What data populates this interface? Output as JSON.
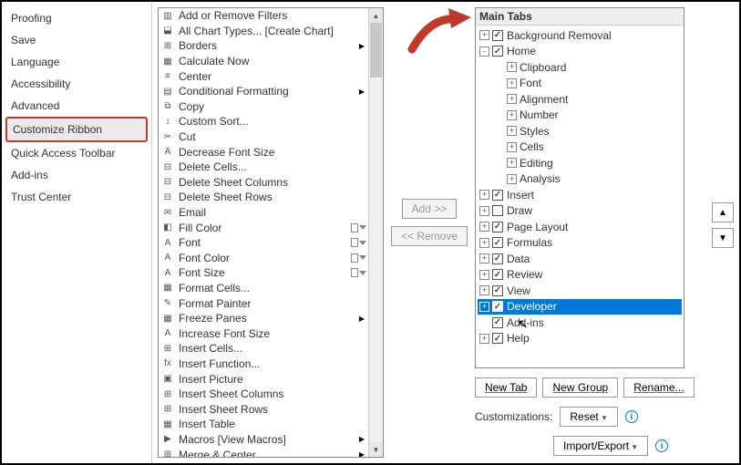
{
  "nav": {
    "items": [
      {
        "label": "Proofing"
      },
      {
        "label": "Save"
      },
      {
        "label": "Language"
      },
      {
        "label": "Accessibility"
      },
      {
        "label": "Advanced"
      },
      {
        "label": "Customize Ribbon",
        "selected": true
      },
      {
        "label": "Quick Access Toolbar"
      },
      {
        "label": "Add-ins"
      },
      {
        "label": "Trust Center"
      }
    ]
  },
  "commands": [
    {
      "label": "Add or Remove Filters"
    },
    {
      "label": "All Chart Types... [Create Chart]"
    },
    {
      "label": "Borders",
      "submenu": true,
      "tail": true
    },
    {
      "label": "Calculate Now"
    },
    {
      "label": "Center"
    },
    {
      "label": "Conditional Formatting",
      "submenu": true
    },
    {
      "label": "Copy"
    },
    {
      "label": "Custom Sort..."
    },
    {
      "label": "Cut"
    },
    {
      "label": "Decrease Font Size"
    },
    {
      "label": "Delete Cells..."
    },
    {
      "label": "Delete Sheet Columns"
    },
    {
      "label": "Delete Sheet Rows"
    },
    {
      "label": "Email"
    },
    {
      "label": "Fill Color",
      "tail": true
    },
    {
      "label": "Font",
      "tail": true
    },
    {
      "label": "Font Color",
      "tail": true
    },
    {
      "label": "Font Size",
      "tail": true
    },
    {
      "label": "Format Cells..."
    },
    {
      "label": "Format Painter"
    },
    {
      "label": "Freeze Panes",
      "submenu": true
    },
    {
      "label": "Increase Font Size"
    },
    {
      "label": "Insert Cells..."
    },
    {
      "label": "Insert Function..."
    },
    {
      "label": "Insert Picture"
    },
    {
      "label": "Insert Sheet Columns"
    },
    {
      "label": "Insert Sheet Rows"
    },
    {
      "label": "Insert Table"
    },
    {
      "label": "Macros [View Macros]",
      "submenu": true
    },
    {
      "label": "Merge & Center",
      "submenu": true
    }
  ],
  "mid": {
    "add_label": "Add >>",
    "remove_label": "<< Remove"
  },
  "tabs": {
    "header": "Main Tabs",
    "items": [
      {
        "depth": 0,
        "exp": "+",
        "chk": true,
        "label": "Background Removal"
      },
      {
        "depth": 0,
        "exp": "-",
        "chk": true,
        "label": "Home"
      },
      {
        "depth": 1,
        "exp": "+",
        "chk": null,
        "label": "Clipboard"
      },
      {
        "depth": 1,
        "exp": "+",
        "chk": null,
        "label": "Font"
      },
      {
        "depth": 1,
        "exp": "+",
        "chk": null,
        "label": "Alignment"
      },
      {
        "depth": 1,
        "exp": "+",
        "chk": null,
        "label": "Number"
      },
      {
        "depth": 1,
        "exp": "+",
        "chk": null,
        "label": "Styles"
      },
      {
        "depth": 1,
        "exp": "+",
        "chk": null,
        "label": "Cells"
      },
      {
        "depth": 1,
        "exp": "+",
        "chk": null,
        "label": "Editing"
      },
      {
        "depth": 1,
        "exp": "+",
        "chk": null,
        "label": "Analysis"
      },
      {
        "depth": 0,
        "exp": "+",
        "chk": true,
        "label": "Insert"
      },
      {
        "depth": 0,
        "exp": "+",
        "chk": false,
        "label": "Draw"
      },
      {
        "depth": 0,
        "exp": "+",
        "chk": true,
        "label": "Page Layout"
      },
      {
        "depth": 0,
        "exp": "+",
        "chk": true,
        "label": "Formulas"
      },
      {
        "depth": 0,
        "exp": "+",
        "chk": true,
        "label": "Data"
      },
      {
        "depth": 0,
        "exp": "+",
        "chk": true,
        "label": "Review"
      },
      {
        "depth": 0,
        "exp": "+",
        "chk": true,
        "label": "View"
      },
      {
        "depth": 0,
        "exp": "+",
        "chk": true,
        "label": "Developer",
        "selected": true
      },
      {
        "depth": 0,
        "exp": "",
        "chk": true,
        "label": "Add-ins"
      },
      {
        "depth": 0,
        "exp": "+",
        "chk": true,
        "label": "Help"
      }
    ]
  },
  "buttons": {
    "new_tab": "New Tab",
    "new_group": "New Group",
    "rename": "Rename..."
  },
  "customizations": {
    "label": "Customizations:",
    "reset": "Reset",
    "import_export": "Import/Export"
  },
  "reorder": {
    "up": "▲",
    "down": "▼"
  }
}
